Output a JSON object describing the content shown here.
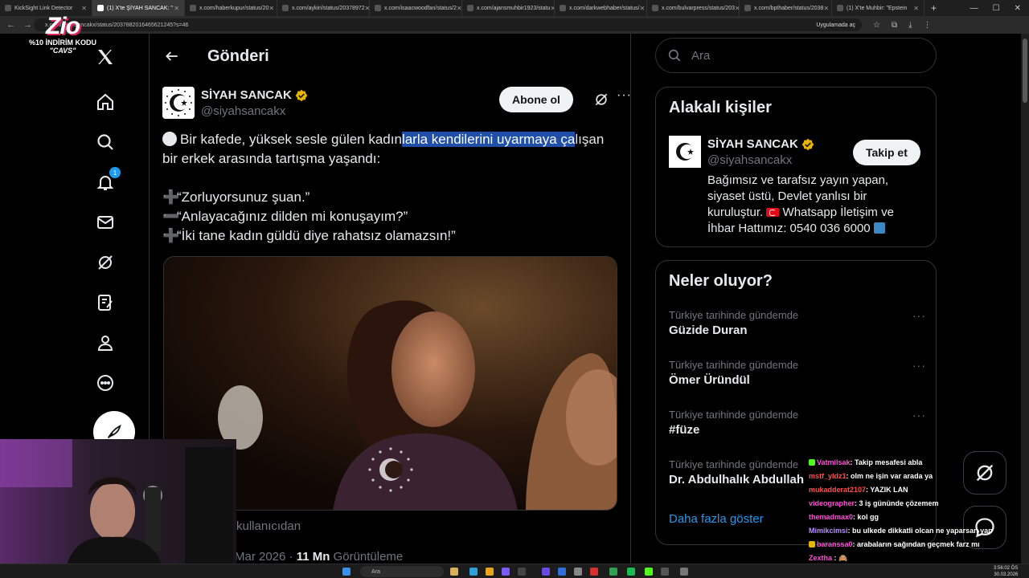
{
  "browser": {
    "tabs": [
      {
        "title": "KickSight Link Detector",
        "active": false
      },
      {
        "title": "(1) X'te ŞİYAH SANCAK: \"",
        "active": true
      },
      {
        "title": "x.com/haberkupur/status/20",
        "active": false
      },
      {
        "title": "x.com/aykiri/status/20378972",
        "active": false
      },
      {
        "title": "x.com/isaacwoodfan/status/2",
        "active": false
      },
      {
        "title": "x.com/ajansmuhbir1923/statu",
        "active": false
      },
      {
        "title": "x.com/darkwebhaber/status/",
        "active": false
      },
      {
        "title": "x.com/bulvarpress/status/203",
        "active": false
      },
      {
        "title": "x.com/bpthaber/status/2038",
        "active": false
      },
      {
        "title": "(1) X'te Muhbir: \"Epstein",
        "active": false
      }
    ],
    "url": "x.com/siyahsancakx/status/2037882016465621245?s=46",
    "open_in_app": "Uygulamada aç"
  },
  "overlay": {
    "brand": "Zio",
    "promo": "%10 İNDİRİM KODU",
    "code": "\"CAVS\""
  },
  "nav": {
    "notification_count": "1"
  },
  "header": {
    "title": "Gönderi"
  },
  "tweet": {
    "author_name": "SİYAH SANCAK",
    "author_handle": "@siyahsancakx",
    "subscribe_label": "Abone ol",
    "line1_pre": "Bir kafede, yüksek sesle gülen kadın",
    "line1_hl": "larla kendilerini uyarmaya ça",
    "line1_post": "lışan",
    "line2": "bir erkek arasında tartışma yaşandı:",
    "quote1": "“Zorluyorsunuz şuan.”",
    "quote2": "“Anlayacağınız dilden mi konuşayım?”",
    "quote3": "“İki tane kadın güldü diye rahatsız olamazsın!”",
    "media_caption": "kullanıcıdan",
    "date": "Mar 2026 · ",
    "views": "11 Mn",
    "views_label": " Görüntüleme"
  },
  "search": {
    "placeholder": "Ara"
  },
  "related": {
    "title": "Alakalı kişiler",
    "name": "SİYAH SANCAK",
    "handle": "@siyahsancakx",
    "follow_label": "Takip et",
    "bio1": "Bağımsız ve tarafsız yayın yapan, siyaset üstü, Devlet yanlısı bir kuruluştur.",
    "bio2": "Whatsapp İletişim ve İhbar Hattımız: 0540 036 6000"
  },
  "trends": {
    "title": "Neler oluyor?",
    "items": [
      {
        "context": "Türkiye tarihinde gündemde",
        "name": "Güzide Duran"
      },
      {
        "context": "Türkiye tarihinde gündemde",
        "name": "Ömer Üründül"
      },
      {
        "context": "Türkiye tarihinde gündemde",
        "name": "#füze"
      },
      {
        "context": "Türkiye tarihinde gündemde",
        "name": "Dr. Abdulhalık Abdullah"
      }
    ],
    "show_more": "Daha fazla göster"
  },
  "chat": [
    {
      "user": "Vatmilsak",
      "msg": "Takip mesafesi abla",
      "color": "#ff4fd8"
    },
    {
      "user": "mstf_yldz1",
      "msg": "olm ne işin var arada ya",
      "color": "#ff4f4f"
    },
    {
      "user": "mukadderat2107",
      "msg": "YAZIK LAN",
      "color": "#ff4f4f"
    },
    {
      "user": "videographer",
      "msg": "3 iş gününde çözemem",
      "color": "#ff4fd8"
    },
    {
      "user": "themadmax0",
      "msg": "kol gg",
      "color": "#ff4fd8"
    },
    {
      "user": "Mimikcimsi",
      "msg": "bu ulkede dikkatli olcan ne yaparsan yap",
      "color": "#b88cff"
    },
    {
      "user": "baranssa0",
      "msg": "arabaların sağından geçmek farz mı",
      "color": "#ff4fd8"
    },
    {
      "user": "Zextha",
      "msg": "",
      "color": "#ff4fd8"
    }
  ],
  "taskbar": {
    "search": "Ara",
    "time": "3:56:02 ÖS",
    "date": "30.03.2026"
  }
}
